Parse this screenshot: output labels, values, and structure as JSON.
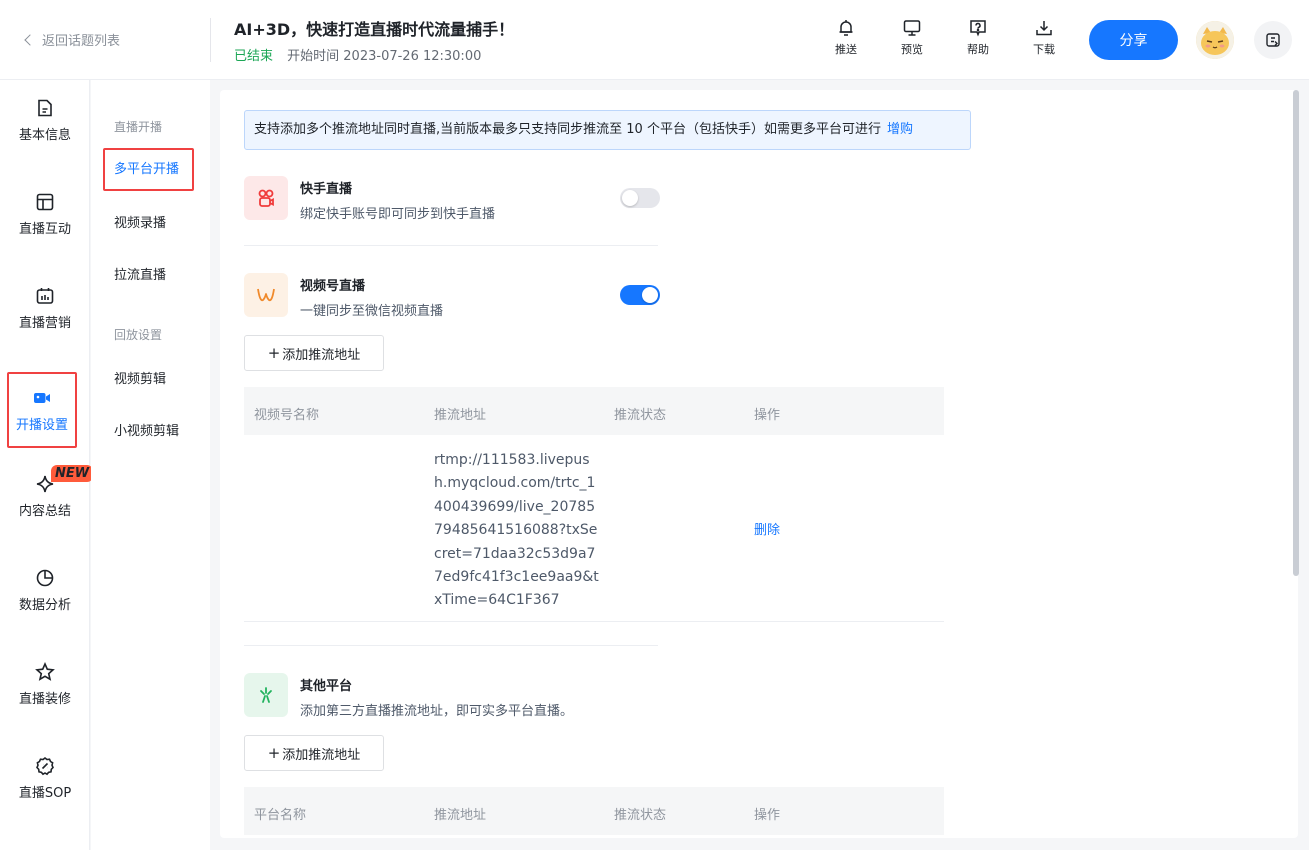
{
  "header": {
    "back_label": "返回话题列表",
    "title": "AI+3D，快速打造直播时代流量捕手！",
    "status": "已结束",
    "start_time": "开始时间 2023-07-26 12:30:00",
    "tools": [
      {
        "label": "推送",
        "icon": "bell-icon"
      },
      {
        "label": "预览",
        "icon": "monitor-icon"
      },
      {
        "label": "帮助",
        "icon": "help-icon"
      },
      {
        "label": "下载",
        "icon": "download-icon"
      }
    ],
    "share_label": "分享"
  },
  "leftnav": {
    "items": [
      {
        "label": "基本信息",
        "icon": "document-icon"
      },
      {
        "label": "直播互动",
        "icon": "layout-icon"
      },
      {
        "label": "直播营销",
        "icon": "calendar-icon"
      },
      {
        "label": "开播设置",
        "icon": "video-camera-icon",
        "active": true
      },
      {
        "label": "内容总结",
        "icon": "sparkle-icon",
        "badge": "NEW"
      },
      {
        "label": "数据分析",
        "icon": "pie-chart-icon"
      },
      {
        "label": "直播装修",
        "icon": "star-icon"
      },
      {
        "label": "直播SOP",
        "icon": "gauge-icon"
      }
    ]
  },
  "subnav": {
    "group1": "直播开播",
    "items1": [
      "多平台开播",
      "视频录播",
      "拉流直播"
    ],
    "group2": "回放设置",
    "items2": [
      "视频剪辑",
      "小视频剪辑"
    ]
  },
  "main": {
    "notice_text": "支持添加多个推流地址同时直播,当前版本最多只支持同步推流至 10 个平台（包括快手）如需更多平台可进行",
    "notice_link": "增购",
    "kuaishou": {
      "name": "快手直播",
      "desc": "绑定快手账号即可同步到快手直播",
      "enabled": false
    },
    "shipinhao": {
      "name": "视频号直播",
      "desc": "一键同步至微信视频直播",
      "enabled": true,
      "add_label": "添加推流地址",
      "columns": [
        "视频号名称",
        "推流地址",
        "推流状态",
        "操作"
      ],
      "rows": [
        {
          "name": "",
          "url": "rtmp://111583.livepush.myqcloud.com/trtc_1400439699/live_2078579485641516088?txSecret=71daa32c53d9a77ed9fc41f3c1ee9aa9&txTime=64C1F367",
          "status": "",
          "action": "删除"
        }
      ]
    },
    "other": {
      "name": "其他平台",
      "desc": "添加第三方直播推流地址，即可实多平台直播。",
      "add_label": "添加推流地址",
      "columns": [
        "平台名称",
        "推流地址",
        "推流状态",
        "操作"
      ]
    }
  },
  "colors": {
    "accent": "#1677ff",
    "ended": "#1ca656",
    "highlight_border": "#f04141"
  }
}
